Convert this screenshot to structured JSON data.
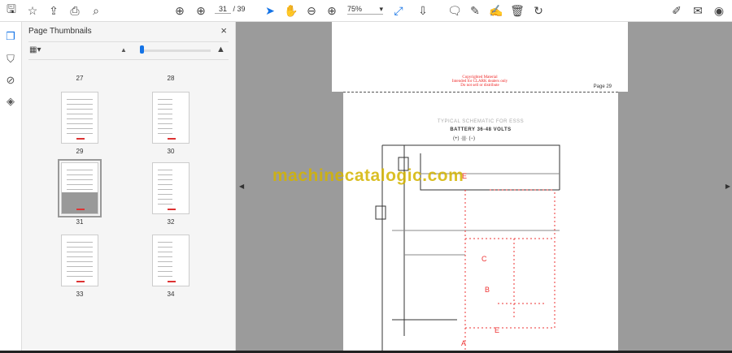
{
  "toolbar": {
    "current_page": "31",
    "total_pages": "/ 39",
    "zoom": "75%"
  },
  "panel": {
    "title": "Page Thumbnails",
    "close": "×"
  },
  "thumbnails": [
    {
      "label": "27"
    },
    {
      "label": "28"
    },
    {
      "label": "29"
    },
    {
      "label": "30"
    },
    {
      "label": "31",
      "selected": true
    },
    {
      "label": "32"
    },
    {
      "label": "33"
    },
    {
      "label": "34"
    }
  ],
  "document": {
    "copyright": [
      "Copyrighted Material",
      "Intended for CLARK dealers only",
      "Do not sell or distribute"
    ],
    "page_number": "Page 29",
    "schematic_title": "TYPICAL SCHEMATIC FOR ESSS",
    "battery_title": "BATTERY 36-48 VOLTS",
    "watermark": "machinecatalogic.com"
  }
}
